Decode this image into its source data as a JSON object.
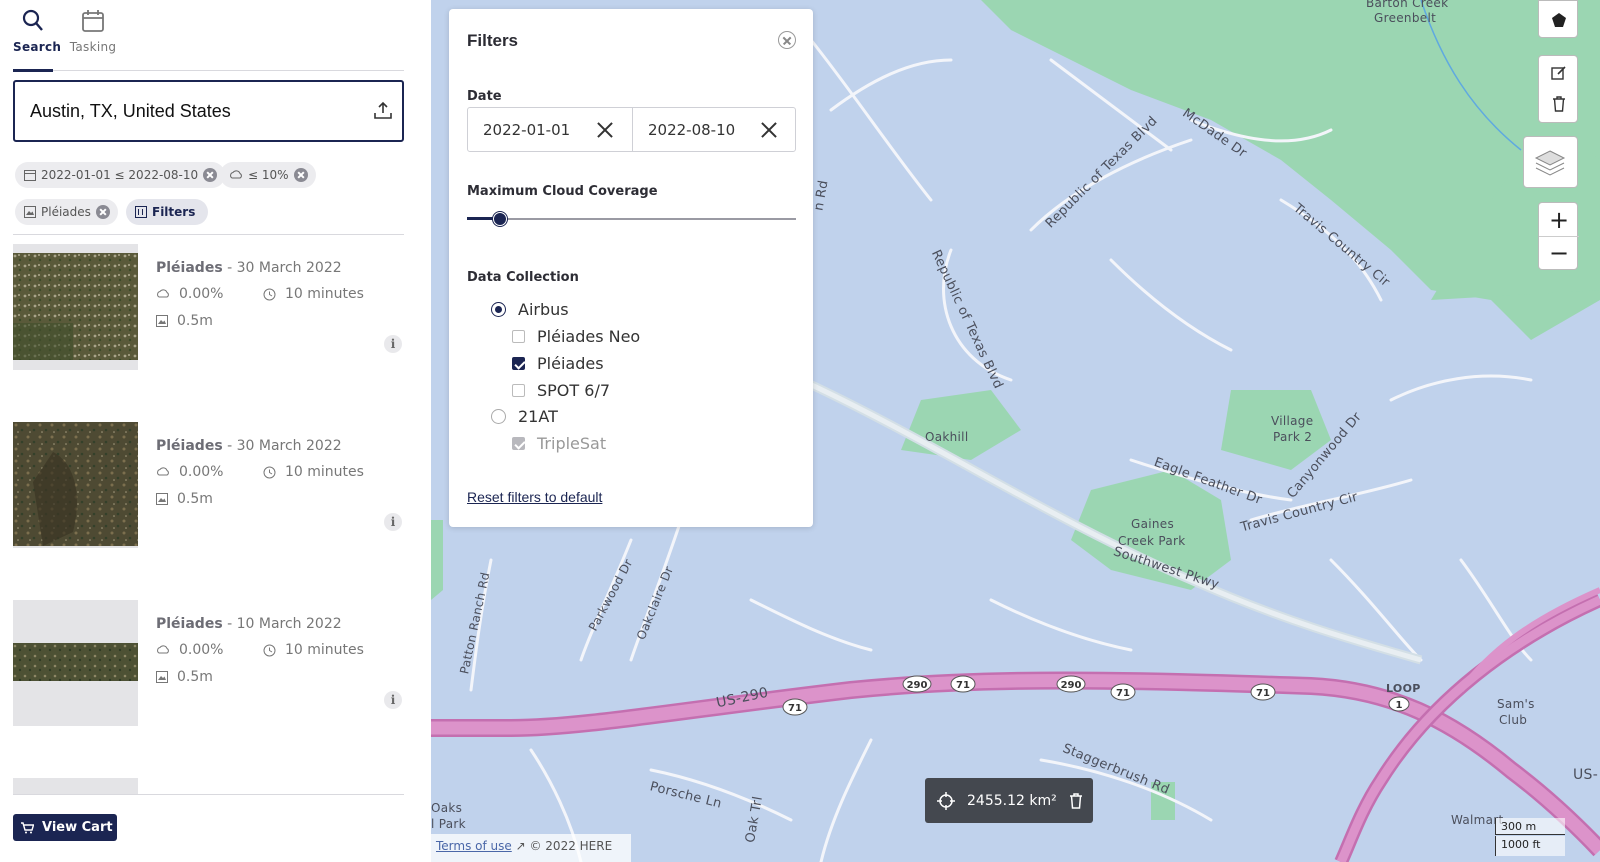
{
  "tabs": [
    {
      "label": "Search",
      "icon": "search-icon",
      "active": true
    },
    {
      "label": "Tasking",
      "icon": "calendar-icon",
      "active": false
    }
  ],
  "search": {
    "value": "Austin, TX, United States"
  },
  "chips": {
    "date": "2022-01-01 ≤ 2022-08-10",
    "cloud": "≤ 10%",
    "satellite": "Pléiades",
    "filters": "Filters"
  },
  "results": [
    {
      "satellite": "Pléiades",
      "date": " - 30 March 2022",
      "cloud": "0.00%",
      "time": "10 minutes",
      "resolution": "0.5m"
    },
    {
      "satellite": "Pléiades",
      "date": " - 30 March 2022",
      "cloud": "0.00%",
      "time": "10 minutes",
      "resolution": "0.5m"
    },
    {
      "satellite": "Pléiades",
      "date": " - 10 March 2022",
      "cloud": "0.00%",
      "time": "10 minutes",
      "resolution": "0.5m"
    }
  ],
  "cart": {
    "label": "View Cart"
  },
  "filters": {
    "title": "Filters",
    "date_label": "Date",
    "date_from": "2022-01-01",
    "date_to": "2022-08-10",
    "cloud_label": "Maximum Cloud Coverage",
    "cloud_value_percent": 10,
    "collection_label": "Data Collection",
    "providers": [
      {
        "label": "Airbus",
        "selected": true,
        "items": [
          {
            "label": "Pléiades Neo",
            "checked": false
          },
          {
            "label": "Pléiades",
            "checked": true
          },
          {
            "label": "SPOT 6/7",
            "checked": false
          }
        ]
      },
      {
        "label": "21AT",
        "selected": false,
        "items": [
          {
            "label": "TripleSat",
            "checked": true,
            "disabled": true
          }
        ]
      }
    ],
    "reset_label": "Reset filters to default"
  },
  "map": {
    "labels": {
      "barton": "Barton Creek",
      "greenbelt": "Greenbelt",
      "mcdade": "McDade Dr",
      "republic1": "Republic of Texas Blvd",
      "republic2": "Republic of Texas Blvd",
      "travis1": "Travis Country Cir",
      "travis2": "Travis Country Cir",
      "village": "Village",
      "park2": "Park 2",
      "canyonwood": "Canyonwood Dr",
      "oakhill": "Oakhill",
      "eagle": "Eagle Feather Dr",
      "gaines1": "Gaines",
      "gaines2": "Creek Park",
      "southwest": "Southwest Pkwy",
      "patton": "Patton Ranch Rd",
      "parkwood": "Parkwood Dr",
      "oakclaire": "Oakclaire Dr",
      "us290": "US-290",
      "loop": "LOOP",
      "sams1": "Sam's",
      "sams2": "Club",
      "stagger": "Staggerbrush Rd",
      "porsche": "Porsche Ln",
      "oaktrl": "Oak Trl",
      "walmart": "Walmart",
      "oaks": "Oaks",
      "lpark": "l Park",
      "us_right": "US-",
      "rd_top": "n Rd"
    },
    "shields": [
      "290",
      "71",
      "71",
      "290",
      "71",
      "71",
      "1"
    ],
    "area": "2455.12 km²",
    "scale_m": "300 m",
    "scale_ft": "1000 ft",
    "attribution_link": "Terms of use",
    "attribution_text": "© 2022 HERE"
  },
  "colors": {
    "accent": "#1b2552",
    "water": "#c0d2ec",
    "park": "#9bd6b2",
    "highway": "#d98bc4"
  }
}
